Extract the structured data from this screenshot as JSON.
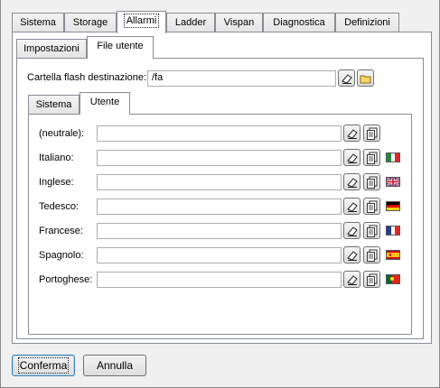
{
  "main_tabs": [
    {
      "label": "Sistema"
    },
    {
      "label": "Storage"
    },
    {
      "label": "Allarmi"
    },
    {
      "label": "Ladder"
    },
    {
      "label": "Vispan"
    },
    {
      "label": "Diagnostica"
    },
    {
      "label": "Definizioni"
    }
  ],
  "main_active": "Allarmi",
  "sub_tabs": [
    {
      "label": "Impostazioni"
    },
    {
      "label": "File utente"
    }
  ],
  "sub_active": "File utente",
  "dest_folder": {
    "label": "Cartella flash destinazione:",
    "value": "/fa"
  },
  "inner_tabs": [
    {
      "label": "Sistema"
    },
    {
      "label": "Utente"
    }
  ],
  "inner_active": "Utente",
  "languages": [
    {
      "label": "(neutrale):",
      "value": "",
      "flag": "none"
    },
    {
      "label": "Italiano:",
      "value": "",
      "flag": "italy-flag"
    },
    {
      "label": "Inglese:",
      "value": "",
      "flag": "uk-flag"
    },
    {
      "label": "Tedesco:",
      "value": "",
      "flag": "germany-flag"
    },
    {
      "label": "Francese:",
      "value": "",
      "flag": "france-flag"
    },
    {
      "label": "Spagnolo:",
      "value": "",
      "flag": "spain-flag"
    },
    {
      "label": "Portoghese:",
      "value": "",
      "flag": "portugal-flag"
    }
  ],
  "buttons": {
    "confirm": "Conferma",
    "cancel": "Annulla"
  },
  "icons": {
    "clear": "eraser-icon",
    "browse": "browse-file-icon",
    "folder": "folder-icon"
  }
}
